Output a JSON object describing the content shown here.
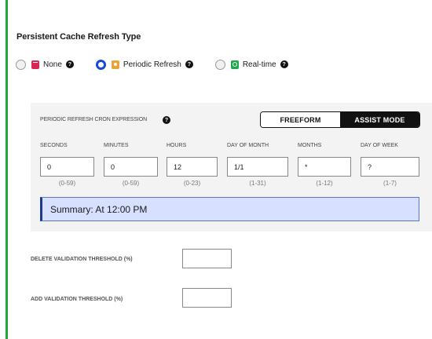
{
  "section": {
    "title": "Persistent Cache Refresh Type"
  },
  "refresh_options": [
    {
      "label": "None",
      "selected": false,
      "icon": "none-icon",
      "color": "#d62652"
    },
    {
      "label": "Periodic Refresh",
      "selected": true,
      "icon": "clock-icon",
      "color": "#e8a33a"
    },
    {
      "label": "Real-time",
      "selected": false,
      "icon": "realtime-icon",
      "color": "#1fa84a"
    }
  ],
  "help_glyph": "?",
  "cron": {
    "label": "PERIODIC REFRESH CRON EXPRESSION",
    "freeform_label": "FREEFORM",
    "assist_label": "ASSIST MODE",
    "active_mode": "ASSIST MODE",
    "fields": [
      {
        "label": "SECONDS",
        "value": "0",
        "range": "(0-59)"
      },
      {
        "label": "MINUTES",
        "value": "0",
        "range": "(0-59)"
      },
      {
        "label": "HOURS",
        "value": "12",
        "range": "(0-23)"
      },
      {
        "label": "DAY OF MONTH",
        "value": "1/1",
        "range": "(1-31)"
      },
      {
        "label": "MONTHS",
        "value": "*",
        "range": "(1-12)"
      },
      {
        "label": "DAY OF WEEK",
        "value": "?",
        "range": "(1-7)"
      }
    ],
    "summary": "Summary: At 12:00 PM"
  },
  "thresholds": {
    "delete_label": "DELETE VALIDATION THRESHOLD (%)",
    "delete_value": "",
    "add_label": "ADD VALIDATION THRESHOLD (%)",
    "add_value": ""
  },
  "colors": {
    "accent": "#22a838",
    "selected_radio": "#1748d9",
    "summary_bg": "#d7e0ff"
  }
}
